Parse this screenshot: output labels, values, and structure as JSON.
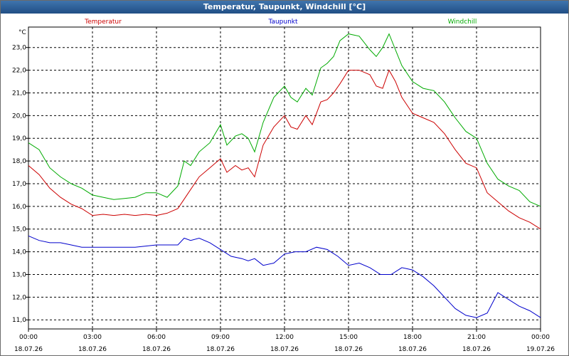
{
  "window": {
    "title": "Temperatur, Taupunkt, Windchill [°C]"
  },
  "chart_data": {
    "type": "line",
    "unit": "°C",
    "ylim": [
      10.6,
      23.9
    ],
    "yticks": [
      "11,0",
      "12,0",
      "13,0",
      "14,0",
      "15,0",
      "16,0",
      "17,0",
      "18,0",
      "19,0",
      "20,0",
      "21,0",
      "22,0",
      "23,0"
    ],
    "ytick_values": [
      11,
      12,
      13,
      14,
      15,
      16,
      17,
      18,
      19,
      20,
      21,
      22,
      23
    ],
    "xlim": [
      0,
      24
    ],
    "xtick_hours": [
      0,
      3,
      6,
      9,
      12,
      15,
      18,
      21,
      24
    ],
    "xtick_times": [
      "00:00",
      "03:00",
      "06:00",
      "09:00",
      "12:00",
      "15:00",
      "18:00",
      "21:00",
      "00:00"
    ],
    "xtick_dates": [
      "18.07.26",
      "18.07.26",
      "18.07.26",
      "18.07.26",
      "18.07.26",
      "18.07.26",
      "18.07.26",
      "18.07.26",
      "19.07.26"
    ],
    "grid": true,
    "series": [
      {
        "name": "Temperatur",
        "color": "#cc0000",
        "points": [
          [
            0,
            17.8
          ],
          [
            0.5,
            17.4
          ],
          [
            1,
            16.8
          ],
          [
            1.5,
            16.4
          ],
          [
            2,
            16.1
          ],
          [
            2.5,
            15.9
          ],
          [
            3,
            15.6
          ],
          [
            3.5,
            15.65
          ],
          [
            4,
            15.6
          ],
          [
            4.5,
            15.65
          ],
          [
            5,
            15.6
          ],
          [
            5.5,
            15.65
          ],
          [
            6,
            15.6
          ],
          [
            6.5,
            15.7
          ],
          [
            7,
            15.9
          ],
          [
            7.5,
            16.6
          ],
          [
            8,
            17.3
          ],
          [
            8.5,
            17.7
          ],
          [
            9,
            18.1
          ],
          [
            9.3,
            17.5
          ],
          [
            9.7,
            17.8
          ],
          [
            10,
            17.6
          ],
          [
            10.3,
            17.7
          ],
          [
            10.6,
            17.3
          ],
          [
            11,
            18.7
          ],
          [
            11.5,
            19.5
          ],
          [
            12,
            20.0
          ],
          [
            12.3,
            19.5
          ],
          [
            12.6,
            19.4
          ],
          [
            13,
            20.0
          ],
          [
            13.3,
            19.6
          ],
          [
            13.7,
            20.6
          ],
          [
            14,
            20.7
          ],
          [
            14.3,
            21.0
          ],
          [
            14.6,
            21.4
          ],
          [
            15,
            22.0
          ],
          [
            15.5,
            22.0
          ],
          [
            16,
            21.8
          ],
          [
            16.3,
            21.3
          ],
          [
            16.6,
            21.2
          ],
          [
            16.9,
            22.0
          ],
          [
            17.2,
            21.5
          ],
          [
            17.5,
            20.8
          ],
          [
            18,
            20.1
          ],
          [
            18.5,
            19.9
          ],
          [
            19,
            19.7
          ],
          [
            19.5,
            19.2
          ],
          [
            20,
            18.5
          ],
          [
            20.5,
            17.9
          ],
          [
            21,
            17.7
          ],
          [
            21.5,
            16.6
          ],
          [
            22,
            16.2
          ],
          [
            22.5,
            15.8
          ],
          [
            23,
            15.5
          ],
          [
            23.5,
            15.3
          ],
          [
            24,
            15.0
          ]
        ]
      },
      {
        "name": "Taupunkt",
        "color": "#0000cc",
        "points": [
          [
            0,
            14.7
          ],
          [
            0.5,
            14.5
          ],
          [
            1,
            14.4
          ],
          [
            1.5,
            14.4
          ],
          [
            2,
            14.3
          ],
          [
            2.5,
            14.2
          ],
          [
            3,
            14.2
          ],
          [
            3.5,
            14.2
          ],
          [
            4,
            14.2
          ],
          [
            4.5,
            14.2
          ],
          [
            5,
            14.2
          ],
          [
            5.5,
            14.25
          ],
          [
            6,
            14.3
          ],
          [
            6.5,
            14.3
          ],
          [
            7,
            14.3
          ],
          [
            7.3,
            14.6
          ],
          [
            7.6,
            14.5
          ],
          [
            8,
            14.6
          ],
          [
            8.5,
            14.4
          ],
          [
            9,
            14.1
          ],
          [
            9.5,
            13.8
          ],
          [
            10,
            13.7
          ],
          [
            10.3,
            13.6
          ],
          [
            10.6,
            13.7
          ],
          [
            11,
            13.4
          ],
          [
            11.5,
            13.5
          ],
          [
            12,
            13.9
          ],
          [
            12.5,
            14.0
          ],
          [
            13,
            14.0
          ],
          [
            13.5,
            14.2
          ],
          [
            14,
            14.1
          ],
          [
            14.5,
            13.8
          ],
          [
            15,
            13.4
          ],
          [
            15.5,
            13.5
          ],
          [
            16,
            13.3
          ],
          [
            16.5,
            13.0
          ],
          [
            17,
            13.0
          ],
          [
            17.5,
            13.3
          ],
          [
            18,
            13.2
          ],
          [
            18.5,
            12.9
          ],
          [
            19,
            12.5
          ],
          [
            19.5,
            12.0
          ],
          [
            20,
            11.5
          ],
          [
            20.5,
            11.2
          ],
          [
            21,
            11.1
          ],
          [
            21.5,
            11.3
          ],
          [
            22,
            12.2
          ],
          [
            22.5,
            11.9
          ],
          [
            23,
            11.6
          ],
          [
            23.5,
            11.4
          ],
          [
            24,
            11.1
          ]
        ]
      },
      {
        "name": "Windchill",
        "color": "#00aa00",
        "points": [
          [
            0,
            18.8
          ],
          [
            0.5,
            18.5
          ],
          [
            1,
            17.7
          ],
          [
            1.5,
            17.3
          ],
          [
            2,
            17.0
          ],
          [
            2.5,
            16.8
          ],
          [
            3,
            16.5
          ],
          [
            3.5,
            16.4
          ],
          [
            4,
            16.3
          ],
          [
            4.5,
            16.35
          ],
          [
            5,
            16.4
          ],
          [
            5.5,
            16.6
          ],
          [
            6,
            16.6
          ],
          [
            6.5,
            16.4
          ],
          [
            7,
            16.9
          ],
          [
            7.3,
            18.0
          ],
          [
            7.6,
            17.8
          ],
          [
            8,
            18.4
          ],
          [
            8.5,
            18.8
          ],
          [
            9,
            19.6
          ],
          [
            9.3,
            18.7
          ],
          [
            9.7,
            19.1
          ],
          [
            10,
            19.2
          ],
          [
            10.3,
            19.0
          ],
          [
            10.6,
            18.4
          ],
          [
            11,
            19.7
          ],
          [
            11.5,
            20.8
          ],
          [
            12,
            21.3
          ],
          [
            12.3,
            20.8
          ],
          [
            12.6,
            20.6
          ],
          [
            13,
            21.2
          ],
          [
            13.3,
            20.9
          ],
          [
            13.7,
            22.1
          ],
          [
            14,
            22.3
          ],
          [
            14.3,
            22.6
          ],
          [
            14.6,
            23.3
          ],
          [
            15,
            23.6
          ],
          [
            15.5,
            23.5
          ],
          [
            16,
            22.9
          ],
          [
            16.3,
            22.6
          ],
          [
            16.6,
            23.0
          ],
          [
            16.9,
            23.6
          ],
          [
            17.2,
            22.9
          ],
          [
            17.5,
            22.2
          ],
          [
            18,
            21.5
          ],
          [
            18.5,
            21.2
          ],
          [
            19,
            21.1
          ],
          [
            19.5,
            20.6
          ],
          [
            20,
            19.9
          ],
          [
            20.5,
            19.3
          ],
          [
            21,
            19.0
          ],
          [
            21.5,
            17.9
          ],
          [
            22,
            17.2
          ],
          [
            22.5,
            16.9
          ],
          [
            23,
            16.7
          ],
          [
            23.5,
            16.2
          ],
          [
            24,
            16.0
          ]
        ]
      }
    ]
  }
}
